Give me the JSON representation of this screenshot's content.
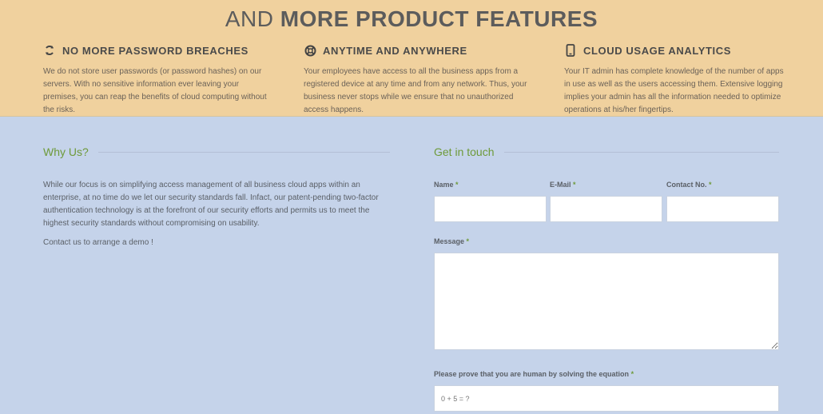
{
  "features": {
    "heading_light": "AND ",
    "heading_bold": "MORE PRODUCT FEATURES",
    "items": [
      {
        "title": "NO MORE PASSWORD BREACHES",
        "icon": "refresh-icon",
        "text": "We do not store user passwords (or password hashes) on our servers. With no sensitive information ever leaving your premises, you can reap the benefits of cloud computing without the risks."
      },
      {
        "title": "ANYTIME AND ANYWHERE",
        "icon": "lifebuoy-icon",
        "text": "Your employees have access to all the business apps from a registered device at any time and from any network. Thus, your business never stops while we ensure that no unauthorized access happens."
      },
      {
        "title": "CLOUD USAGE ANALYTICS",
        "icon": "mobile-icon",
        "text": "Your IT admin has complete knowledge of the number of apps in use as well as the users accessing them. Extensive logging implies your admin has all the information needed to optimize operations at his/her fingertips."
      }
    ]
  },
  "why": {
    "title": "Why Us?",
    "paragraph1": "While our focus is on simplifying access management of all business cloud apps within an enterprise, at no time do we let our security standards fall. Infact, our patent-pending two-factor authentication technology is at the forefront of our security efforts and permits us to meet the highest security standards without compromising on usability.",
    "paragraph2": "Contact us to arrange a demo !"
  },
  "contact": {
    "title": "Get in touch",
    "required_mark": "*",
    "name_label": "Name",
    "email_label": "E-Mail",
    "phone_label": "Contact No.",
    "message_label": "Message",
    "captcha_label": "Please prove that you are human by solving the equation",
    "captcha_placeholder": "0 + 5 = ?"
  }
}
